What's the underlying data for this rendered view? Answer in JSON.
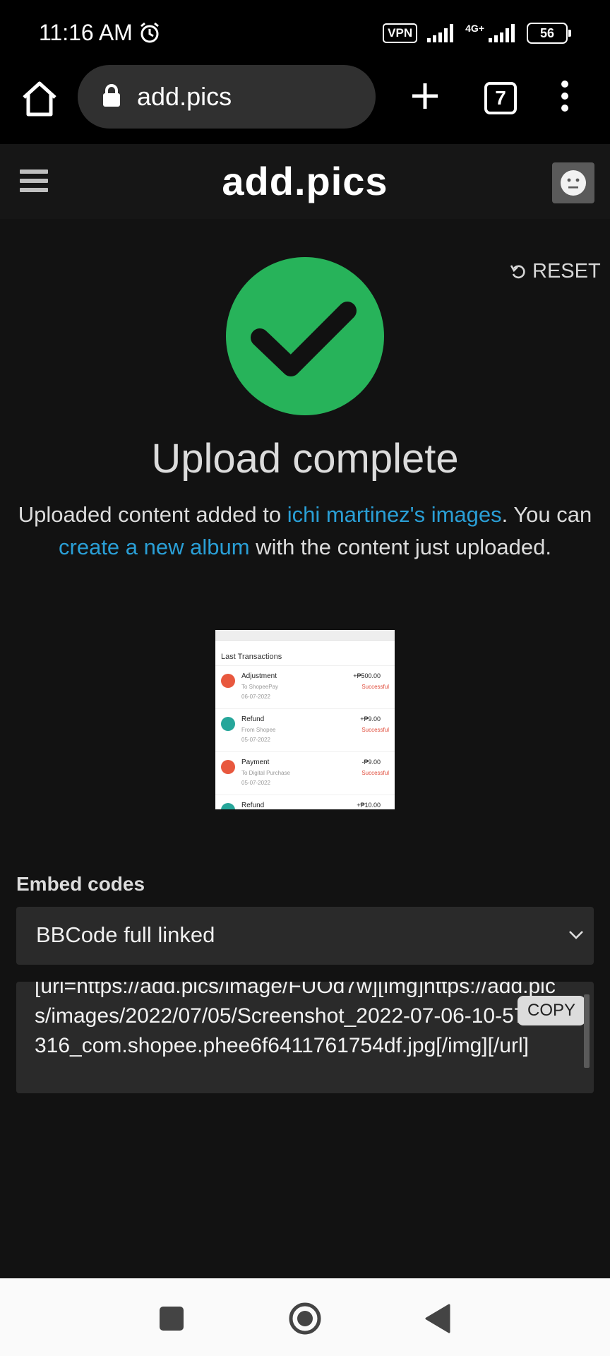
{
  "status_bar": {
    "time": "11:16 AM",
    "vpn": "VPN",
    "network": "4G+",
    "battery": "56"
  },
  "browser": {
    "url": "add.pics",
    "tab_count": "7"
  },
  "site": {
    "logo": "add.pics",
    "reset_label": "RESET"
  },
  "upload": {
    "title": "Upload complete",
    "desc_prefix": "Uploaded content added to ",
    "desc_link1": "ichi martinez's images",
    "desc_mid": ". You can ",
    "desc_link2": "create a new album",
    "desc_suffix": " with the content just uploaded."
  },
  "thumbnail": {
    "heading": "Last Transactions",
    "transactions": [
      {
        "name": "Adjustment",
        "sub": "To ShopeePay",
        "date": "06-07-2022",
        "amount": "+₱500.00",
        "status": "Successful",
        "color": "#e8583e"
      },
      {
        "name": "Refund",
        "sub": "From Shopee",
        "date": "05-07-2022",
        "amount": "+₱9.00",
        "status": "Successful",
        "color": "#26a69a"
      },
      {
        "name": "Payment",
        "sub": "To Digital Purchase",
        "date": "05-07-2022",
        "amount": "-₱9.00",
        "status": "Successful",
        "color": "#e8583e"
      },
      {
        "name": "Refund",
        "sub": "",
        "date": "",
        "amount": "+₱10.00",
        "status": "",
        "color": "#26a69a"
      }
    ]
  },
  "embed": {
    "label": "Embed codes",
    "selected": "BBCode full linked",
    "code": "[url=https://add.pics/image/FUOd7w][img]https://add.pics/images/2022/07/05/Screenshot_2022-07-06-10-57-52-316_com.shopee.phee6f6411761754df.jpg[/img][/url]",
    "copy_label": "COPY"
  },
  "colors": {
    "accent_link": "#2a9fd6",
    "success": "#27b35a",
    "background": "#121212"
  }
}
